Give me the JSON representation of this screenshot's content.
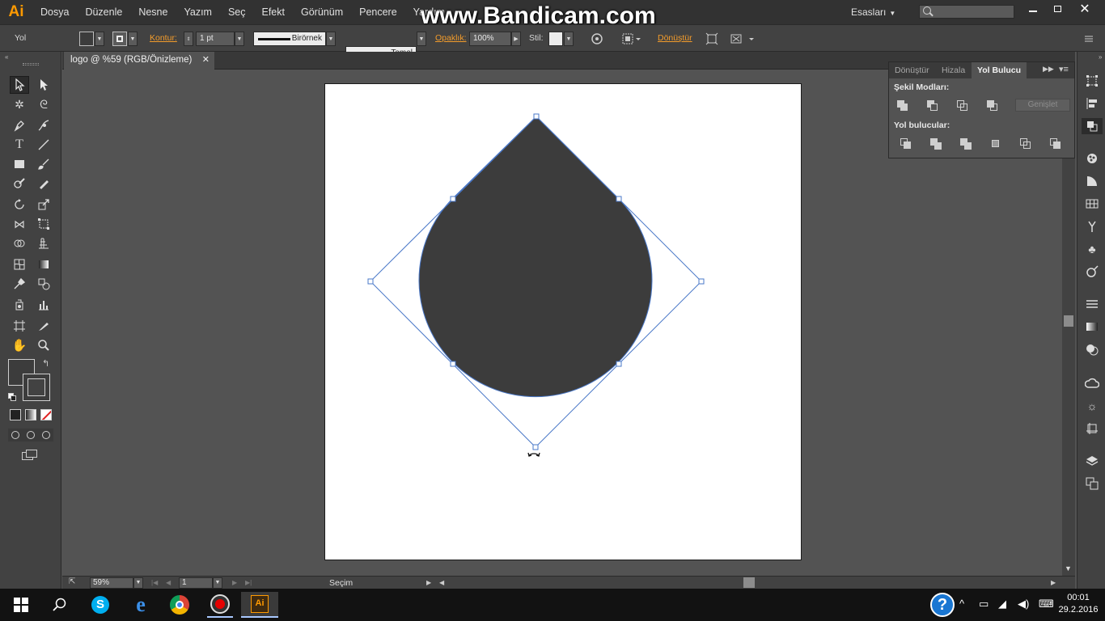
{
  "app": {
    "logo_text": "Ai",
    "menu": [
      "Dosya",
      "Düzenle",
      "Nesne",
      "Yazım",
      "Seç",
      "Efekt",
      "Görünüm",
      "Pencere",
      "Yardım"
    ],
    "watermark": "www.Bandicam.com",
    "workspace": "Esasları"
  },
  "control": {
    "selection_type": "Yol",
    "stroke_label": "Kontur:",
    "stroke_weight": "1 pt",
    "profile_label": "Birörnek",
    "brush_label": "Temel",
    "opacity_label": "Opaklık:",
    "opacity_value": "100%",
    "style_label": "Stil:",
    "transform_label": "Dönüştür"
  },
  "document": {
    "tab_title": "logo @ %59 (RGB/Önizleme)"
  },
  "status": {
    "zoom": "59%",
    "artboard_number": "1",
    "tool_name": "Seçim"
  },
  "pathfinder": {
    "tabs": [
      "Dönüştür",
      "Hizala",
      "Yol Bulucu"
    ],
    "shape_modes_label": "Şekil Modları:",
    "pathfinders_label": "Yol bulucular:",
    "expand_label": "Genişlet"
  },
  "taskbar": {
    "time": "00:01",
    "date": "29.2.2016"
  },
  "colors": {
    "shape_fill": "#3c3c3c",
    "selection": "#4a78c8",
    "accent_orange": "#f39c2b"
  }
}
